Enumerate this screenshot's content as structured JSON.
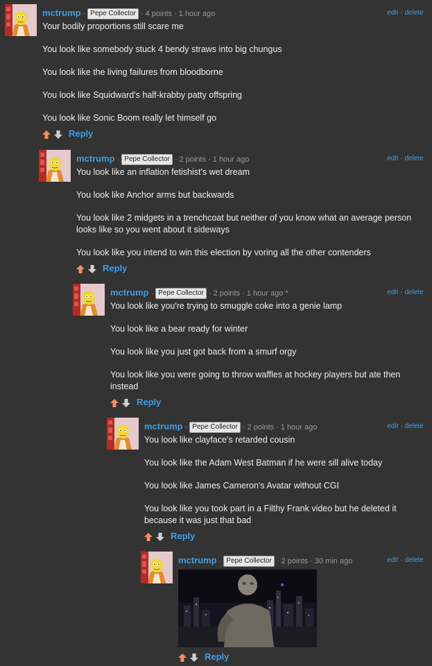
{
  "comments": [
    {
      "user": "mctrump",
      "badge": "Pepe Collector",
      "points": "4 points",
      "time": "1 hour ago",
      "edit": "edit",
      "delete": "delete",
      "lines": [
        "Your bodily proportions still scare me",
        "You look like somebody stuck 4 bendy straws into big chungus",
        "You look like the living failures from bloodborne",
        "You look like Squidward's half-krabby patty offspring",
        "You look like Sonic Boom really let himself go"
      ],
      "reply": "Reply"
    },
    {
      "user": "mctrump",
      "badge": "Pepe Collector",
      "points": "2 points",
      "time": "1 hour ago",
      "edit": "edit",
      "delete": "delete",
      "lines": [
        "You look like an inflation fetishist's wet dream",
        "You look like Anchor arms but backwards",
        "You look like 2 midgets in a trenchcoat but neither of you know what an average person looks like so you went about it sideways",
        "You look like you intend to win this election by voring all the other contenders"
      ],
      "reply": "Reply"
    },
    {
      "user": "mctrump",
      "badge": "Pepe Collector",
      "points": "2 points",
      "time": "1 hour ago *",
      "edit": "edit",
      "delete": "delete",
      "lines": [
        "You look like you're trying to smuggle coke into a genie lamp",
        "You look like a bear ready for winter",
        "You look like you just got back from a smurf orgy",
        "You look like you were going to throw waffles at hockey players but ate then instead"
      ],
      "reply": "Reply"
    },
    {
      "user": "mctrump",
      "badge": "Pepe Collector",
      "points": "2 points",
      "time": "1 hour ago",
      "edit": "edit",
      "delete": "delete",
      "lines": [
        "You look like clayface's retarded cousin",
        "You look like the Adam West Batman if he were sill alive today",
        "You look like James Cameron's Avatar without CGI",
        "You look like you took part in a Filthy Frank video but he deleted it because it was just that bad"
      ],
      "reply": "Reply"
    },
    {
      "user": "mctrump",
      "badge": "Pepe Collector",
      "points": "2 points",
      "time": "30 min ago",
      "edit": "edit",
      "delete": "delete",
      "lines": [],
      "reply": "Reply"
    }
  ],
  "colors": {
    "background": "#333333",
    "link": "#3d9ee5",
    "upvote": "#ff8b60",
    "downvote": "#d0d0d0"
  }
}
